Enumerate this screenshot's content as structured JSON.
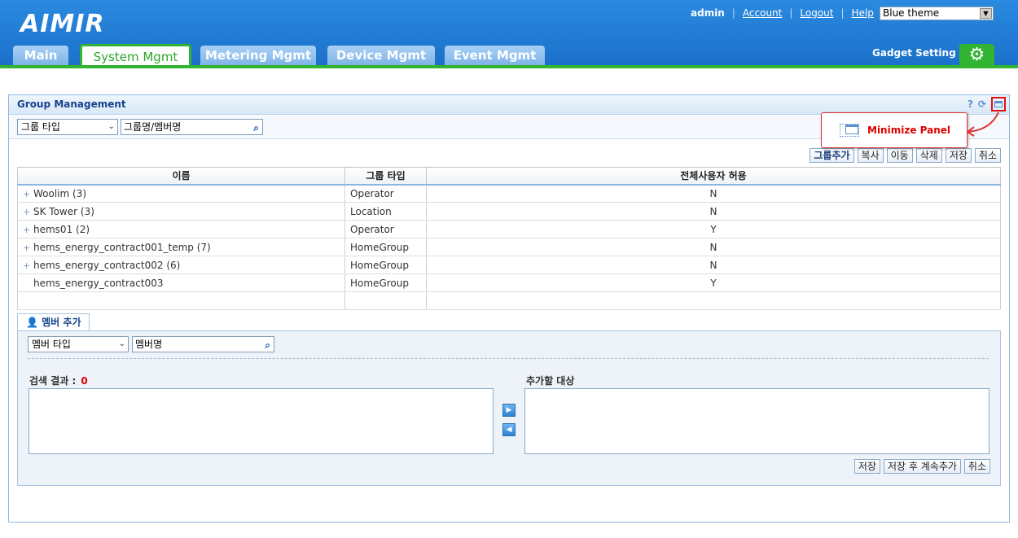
{
  "header": {
    "logo": "AIMIR",
    "user": "admin",
    "links": [
      "Account",
      "Logout",
      "Help"
    ],
    "theme": "Blue theme",
    "tabs": [
      "Main",
      "System Mgmt",
      "Metering Mgmt",
      "Device Mgmt",
      "Event Mgmt"
    ],
    "gadget_label": "Gadget Setting",
    "brand_color": "#1b6fc8",
    "accent_color": "#31b431"
  },
  "panel": {
    "title": "Group Management",
    "help": "?",
    "refresh": "⟳",
    "search": {
      "type_select": "그룹 타입",
      "name_input": "그룹명/멤버명"
    },
    "actions": [
      "그룹추가",
      "복사",
      "이동",
      "삭제",
      "저장",
      "취소"
    ],
    "columns": [
      "이름",
      "그룹 타입",
      "전체사용자 허용"
    ],
    "rows": [
      {
        "expand": "+",
        "name": "Woolim",
        "count": "(3)",
        "type": "Operator",
        "allow": "N"
      },
      {
        "expand": "+",
        "name": "SK Tower",
        "count": "(3)",
        "type": "Location",
        "allow": "N"
      },
      {
        "expand": "+",
        "name": "hems01",
        "count": "(2)",
        "type": "Operator",
        "allow": "Y"
      },
      {
        "expand": "+",
        "name": "hems_energy_contract001_temp",
        "count": "(7)",
        "type": "HomeGroup",
        "allow": "N"
      },
      {
        "expand": "+",
        "name": "hems_energy_contract002",
        "count": "(6)",
        "type": "HomeGroup",
        "allow": "N"
      },
      {
        "expand": "",
        "name": "hems_energy_contract003",
        "count": "",
        "type": "HomeGroup",
        "allow": "Y"
      }
    ]
  },
  "member": {
    "tab_label": "멤버 추가",
    "type_select": "멤버 타입",
    "name_input": "멤버명",
    "result_label": "검색 결과 :",
    "result_count": "0",
    "target_label": "추가할 대상",
    "actions": [
      "저장",
      "저장 후 계속추가",
      "취소"
    ]
  },
  "callout": {
    "text": "Minimize Panel",
    "color": "#e03030"
  }
}
